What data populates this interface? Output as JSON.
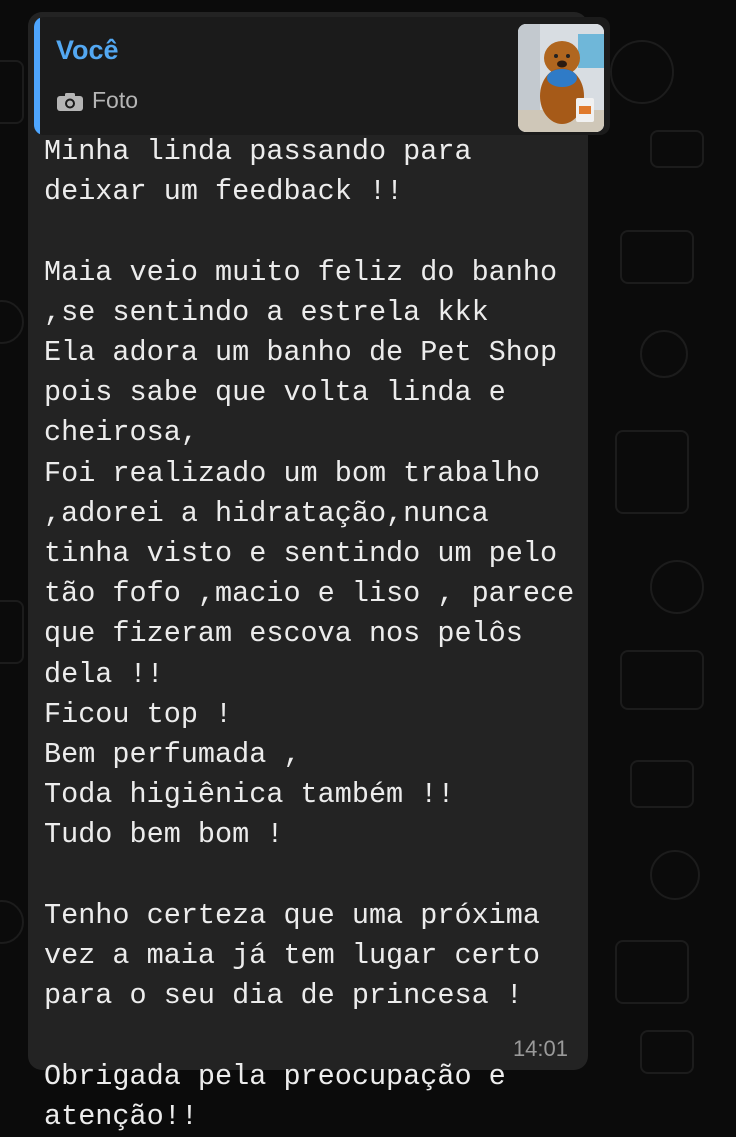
{
  "quote": {
    "author": "Você",
    "type_label": "Foto",
    "type_icon": "camera-icon",
    "accent_color": "#53a8f2"
  },
  "message": {
    "text": "Minha linda passando para deixar um feedback !!\n\nMaia veio muito feliz do banho ,se sentindo a estrela kkk\nEla adora um banho de Pet Shop pois sabe que volta linda e  cheirosa,\nFoi realizado um bom trabalho ,adorei a hidratação,nunca tinha visto e sentindo um pelo tão fofo ,macio e liso , parece que fizeram escova nos pelôs dela !!\nFicou top !\nBem perfumada ,\nToda higiênica também !!\nTudo bem bom !\n\nTenho certeza que uma próxima vez a maia já tem lugar certo para o seu dia de princesa !\n\nObrigada pela preocupação e atenção!!",
    "time": "14:01"
  },
  "colors": {
    "bubble": "#232323",
    "background": "#0b0b0b",
    "text": "#ececec"
  }
}
